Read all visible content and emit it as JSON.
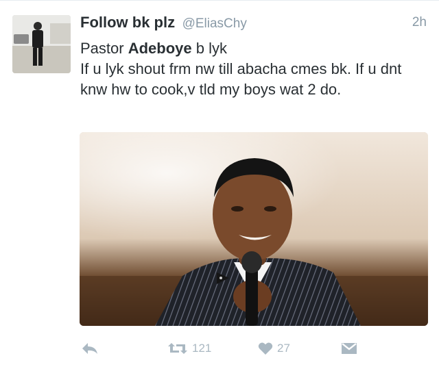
{
  "tweet": {
    "display_name": "Follow bk plz",
    "handle": "@EliasChy",
    "time": "2h",
    "text_line1_prefix": "Pastor ",
    "text_line1_bold": "Adeboye",
    "text_line1_suffix": " b lyk",
    "text_body": "If u lyk shout frm nw till abacha cmes bk. If u dnt knw hw to cook,v tld my boys wat 2 do.",
    "retweet_count": "121",
    "like_count": "27"
  },
  "colors": {
    "name": "#292f33",
    "muted": "#8899a6",
    "action_icons": "#aab8c2"
  },
  "icons": {
    "reply": "reply-icon",
    "retweet": "retweet-icon",
    "like": "heart-icon",
    "message": "direct-message-icon"
  }
}
